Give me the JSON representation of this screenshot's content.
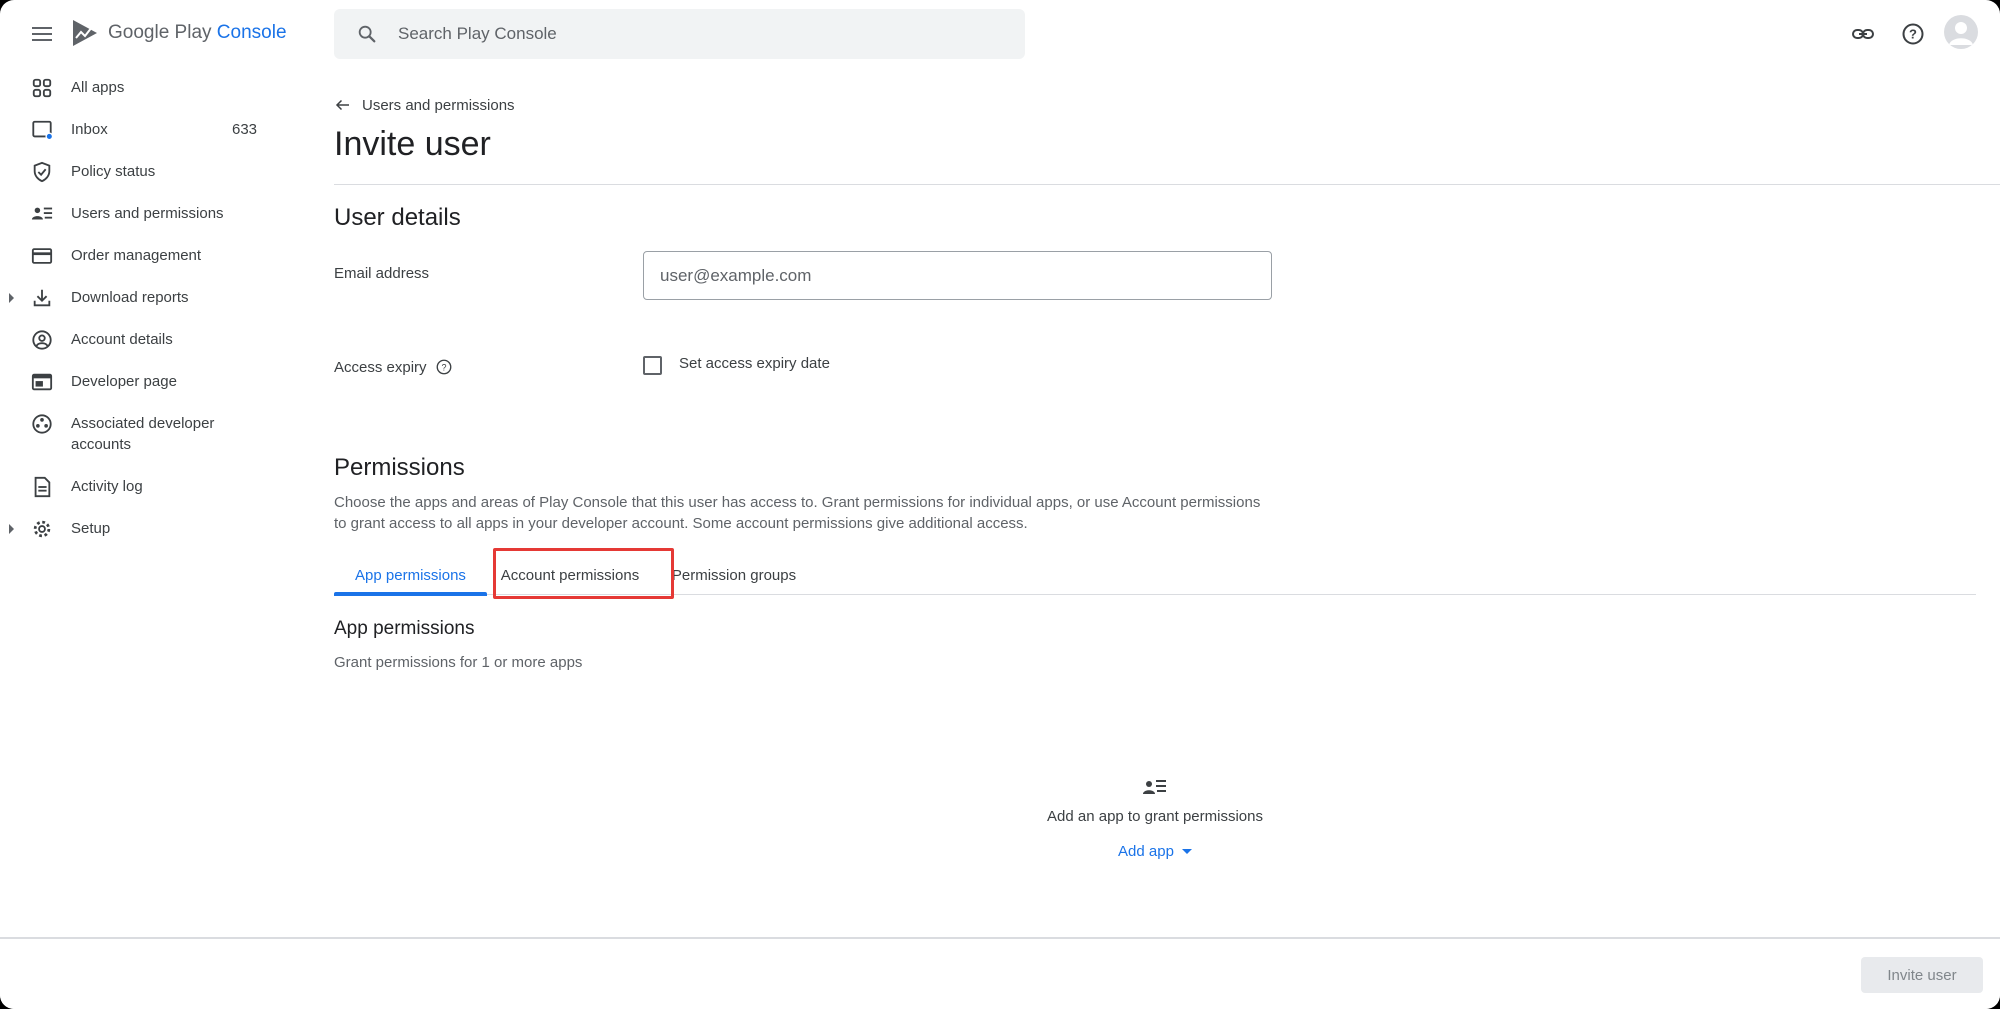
{
  "brand": {
    "name": "Google Play",
    "product": "Console"
  },
  "search": {
    "placeholder": "Search Play Console"
  },
  "sidebar": {
    "items": [
      {
        "label": "All apps",
        "icon": "grid-icon"
      },
      {
        "label": "Inbox",
        "icon": "inbox-icon",
        "count": "633"
      },
      {
        "label": "Policy status",
        "icon": "shield-check-icon"
      },
      {
        "label": "Users and permissions",
        "icon": "users-list-icon"
      },
      {
        "label": "Order management",
        "icon": "credit-card-icon"
      },
      {
        "label": "Download reports",
        "icon": "download-icon",
        "expandable": true
      },
      {
        "label": "Account details",
        "icon": "account-circle-icon"
      },
      {
        "label": "Developer page",
        "icon": "web-page-icon"
      },
      {
        "label": "Associated developer accounts",
        "icon": "linked-accounts-icon"
      },
      {
        "label": "Activity log",
        "icon": "document-icon"
      },
      {
        "label": "Setup",
        "icon": "gear-icon",
        "expandable": true
      }
    ]
  },
  "breadcrumb": {
    "label": "Users and permissions"
  },
  "page": {
    "title": "Invite user"
  },
  "user_details": {
    "heading": "User details",
    "email_label": "Email address",
    "email_placeholder": "user@example.com",
    "access_expiry_label": "Access expiry",
    "expiry_checkbox_label": "Set access expiry date",
    "expiry_checked": false
  },
  "permissions": {
    "heading": "Permissions",
    "description": "Choose the apps and areas of Play Console that this user has access to. Grant permissions for individual apps, or use Account permissions to grant access to all apps in your developer account. Some account permissions give additional access.",
    "tabs": [
      {
        "label": "App permissions",
        "active": true
      },
      {
        "label": "Account permissions",
        "active": false,
        "highlighted": true
      },
      {
        "label": "Permission groups",
        "active": false
      }
    ],
    "app_permissions": {
      "heading": "App permissions",
      "subtitle": "Grant permissions for 1 or more apps",
      "empty_text": "Add an app to grant permissions",
      "add_label": "Add app"
    }
  },
  "footer": {
    "invite_label": "Invite user",
    "invite_disabled": true
  },
  "colors": {
    "accent": "#1a73e8",
    "highlight": "#e53935",
    "text": "#202124",
    "muted": "#5f6368"
  }
}
